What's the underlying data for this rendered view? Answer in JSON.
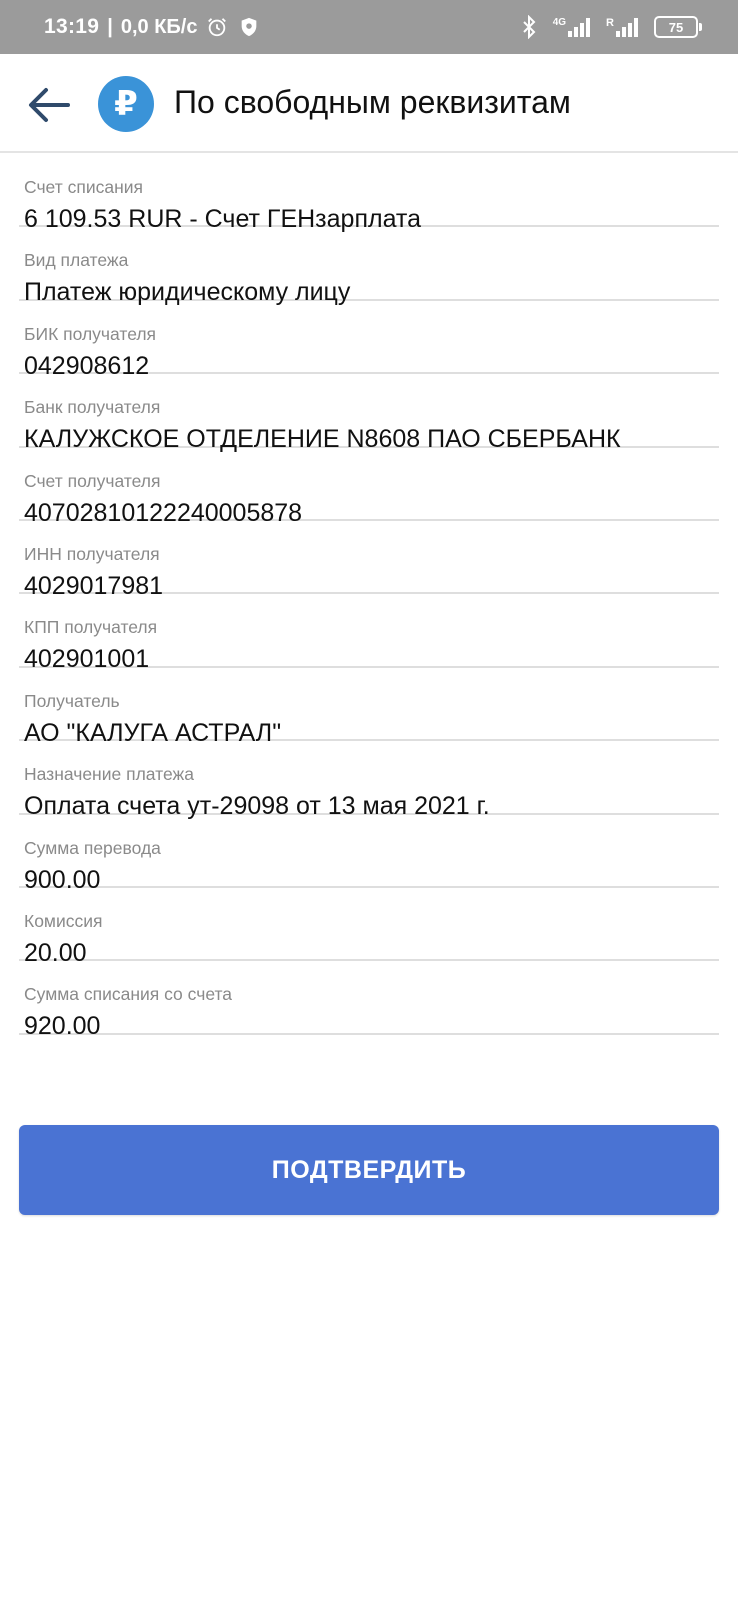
{
  "status_bar": {
    "time": "13:19",
    "separator": "|",
    "speed": "0,0 КБ/с",
    "network_label_1": "4G",
    "network_label_2": "R",
    "battery": "75"
  },
  "header": {
    "title": "По свободным реквизитам",
    "ruble_symbol": "₽",
    "accent_color": "#3a93d8"
  },
  "fields": [
    {
      "label": "Счет списания",
      "value": "6 109.53 RUR - Счет ГЕНзарплата"
    },
    {
      "label": "Вид платежа",
      "value": "Платеж юридическому лицу"
    },
    {
      "label": "БИК получателя",
      "value": "042908612"
    },
    {
      "label": "Банк получателя",
      "value": "КАЛУЖСКОЕ ОТДЕЛЕНИЕ N8608 ПАО СБЕРБАНК"
    },
    {
      "label": "Счет получателя",
      "value": "40702810122240005878"
    },
    {
      "label": "ИНН получателя",
      "value": "4029017981"
    },
    {
      "label": "КПП получателя",
      "value": "402901001"
    },
    {
      "label": "Получатель",
      "value": "АО \"КАЛУГА АСТРАЛ\""
    },
    {
      "label": "Назначение платежа",
      "value": "Оплата счета ут-29098 от 13 мая 2021 г."
    },
    {
      "label": "Сумма перевода",
      "value": "900.00"
    },
    {
      "label": "Комиссия",
      "value": "20.00"
    },
    {
      "label": "Сумма списания со счета",
      "value": "920.00"
    }
  ],
  "actions": {
    "confirm_label": "ПОДТВЕРДИТЬ",
    "confirm_color": "#4a73d3"
  }
}
